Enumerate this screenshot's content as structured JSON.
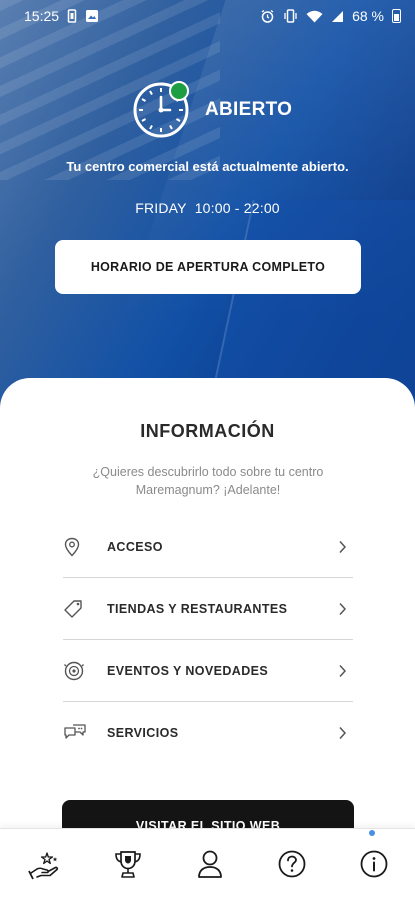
{
  "status_bar": {
    "time": "15:25",
    "battery": "68 %",
    "icons_left": [
      "phone-vibrate-icon",
      "image-icon"
    ],
    "icons_right": [
      "alarm-icon",
      "vibrate-icon",
      "wifi-icon",
      "signal-icon",
      "battery-icon"
    ]
  },
  "status": {
    "title": "ABIERTO",
    "description": "Tu centro comercial está actualmente abierto.",
    "day": "FRIDAY",
    "hours": "10:00 - 22:00",
    "indicator_color": "#1e9e43"
  },
  "schedule_button": "HORARIO DE APERTURA COMPLETO",
  "info": {
    "title": "INFORMACIÓN",
    "subtitle_line1": "¿Quieres descubrirlo todo sobre tu centro",
    "subtitle_line2": "Maremagnum? ¡Adelante!",
    "items": [
      {
        "label": "ACCESO",
        "icon": "location-pin-icon"
      },
      {
        "label": "TIENDAS Y RESTAURANTES",
        "icon": "tag-icon"
      },
      {
        "label": "EVENTOS Y NOVEDADES",
        "icon": "events-icon"
      },
      {
        "label": "SERVICIOS",
        "icon": "chat-bubbles-icon"
      }
    ]
  },
  "website_button": "VISITAR EL SITIO WEB",
  "bottom_nav": [
    {
      "name": "rewards",
      "icon": "hand-stars-icon"
    },
    {
      "name": "trophy",
      "icon": "trophy-icon"
    },
    {
      "name": "profile",
      "icon": "user-icon"
    },
    {
      "name": "help",
      "icon": "help-icon"
    },
    {
      "name": "info",
      "icon": "info-icon",
      "active": true
    }
  ],
  "colors": {
    "hero_blue": "#0d3f8a",
    "accent_dot": "#4a90e2",
    "button_dark": "#141414"
  }
}
